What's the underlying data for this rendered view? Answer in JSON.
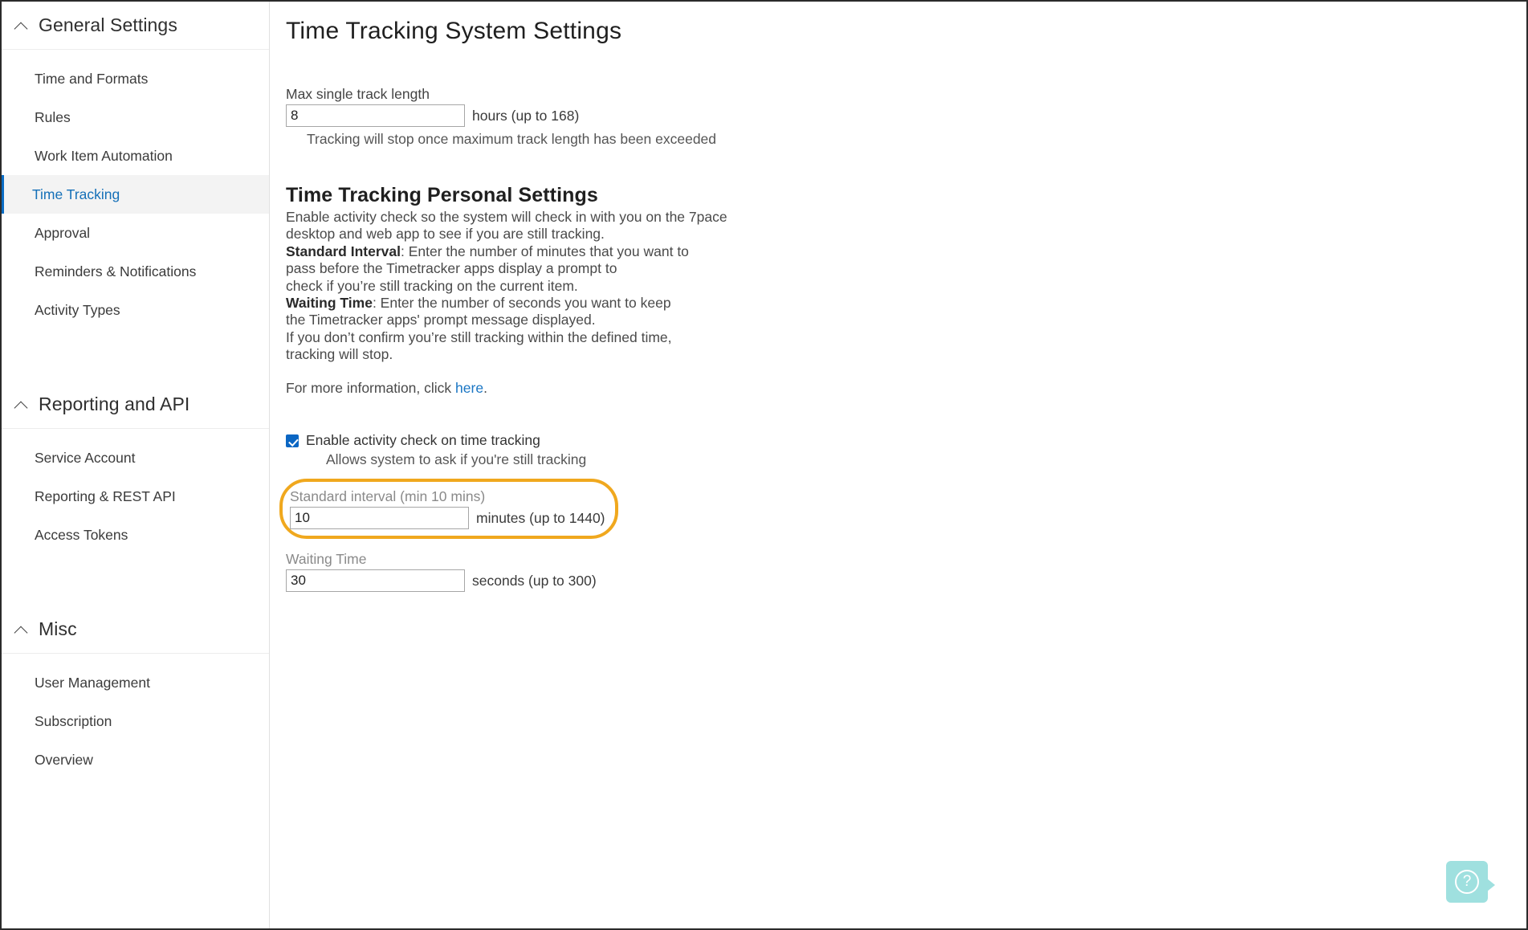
{
  "sidebar": {
    "groups": [
      {
        "title": "General Settings",
        "icon": "chevron-up-icon",
        "items": [
          {
            "label": "Time and Formats",
            "selected": false
          },
          {
            "label": "Rules",
            "selected": false
          },
          {
            "label": "Work Item Automation",
            "selected": false
          },
          {
            "label": "Time Tracking",
            "selected": true
          },
          {
            "label": "Approval",
            "selected": false
          },
          {
            "label": "Reminders & Notifications",
            "selected": false
          },
          {
            "label": "Activity Types",
            "selected": false
          }
        ]
      },
      {
        "title": "Reporting and API",
        "icon": "chevron-up-icon",
        "items": [
          {
            "label": "Service Account",
            "selected": false
          },
          {
            "label": "Reporting & REST API",
            "selected": false
          },
          {
            "label": "Access Tokens",
            "selected": false
          }
        ]
      },
      {
        "title": "Misc",
        "icon": "chevron-up-icon",
        "items": [
          {
            "label": "User Management",
            "selected": false
          },
          {
            "label": "Subscription",
            "selected": false
          },
          {
            "label": "Overview",
            "selected": false
          }
        ]
      }
    ]
  },
  "main": {
    "page_title": "Time Tracking System Settings",
    "max_track": {
      "label": "Max single track length",
      "value": "8",
      "suffix": "hours (up to 168)",
      "hint": "Tracking will stop once maximum track length has been exceeded"
    },
    "personal": {
      "title": "Time Tracking Personal Settings",
      "lines": [
        "Enable activity check so the system will check in with you on the 7pace",
        "desktop and web app to see if you are still tracking."
      ],
      "standard_interval_bold": "Standard Interval",
      "standard_interval_lines": [
        ": Enter the number of minutes that you want to",
        "pass before the Timetracker apps display a prompt to",
        "check if you’re still tracking on the current item."
      ],
      "waiting_time_bold": "Waiting Time",
      "waiting_time_lines": [
        ": Enter the number of seconds you want to keep",
        "the Timetracker apps' prompt message displayed.",
        "If you don’t confirm you’re still tracking within the defined time,",
        "tracking will stop."
      ],
      "more_info_prefix": "For more information, click ",
      "more_info_link": "here",
      "more_info_suffix": "."
    },
    "enable_check": {
      "label": "Enable activity check on time tracking",
      "sub": "Allows system to ask if you're still tracking",
      "checked": true
    },
    "standard_interval_field": {
      "label": "Standard interval (min 10 mins)",
      "value": "10",
      "suffix": "minutes (up to 1440)",
      "highlighted": true
    },
    "waiting_time_field": {
      "label": "Waiting Time",
      "value": "30",
      "suffix": "seconds (up to 300)"
    }
  },
  "help": {
    "icon": "question-mark-icon",
    "label": "?"
  },
  "colors": {
    "accent_link": "#1a76c4",
    "selected_nav": "#1570b8",
    "highlight_ring": "#f0a81e",
    "checkbox": "#0b66c3",
    "help_bg": "#9fe0df"
  }
}
